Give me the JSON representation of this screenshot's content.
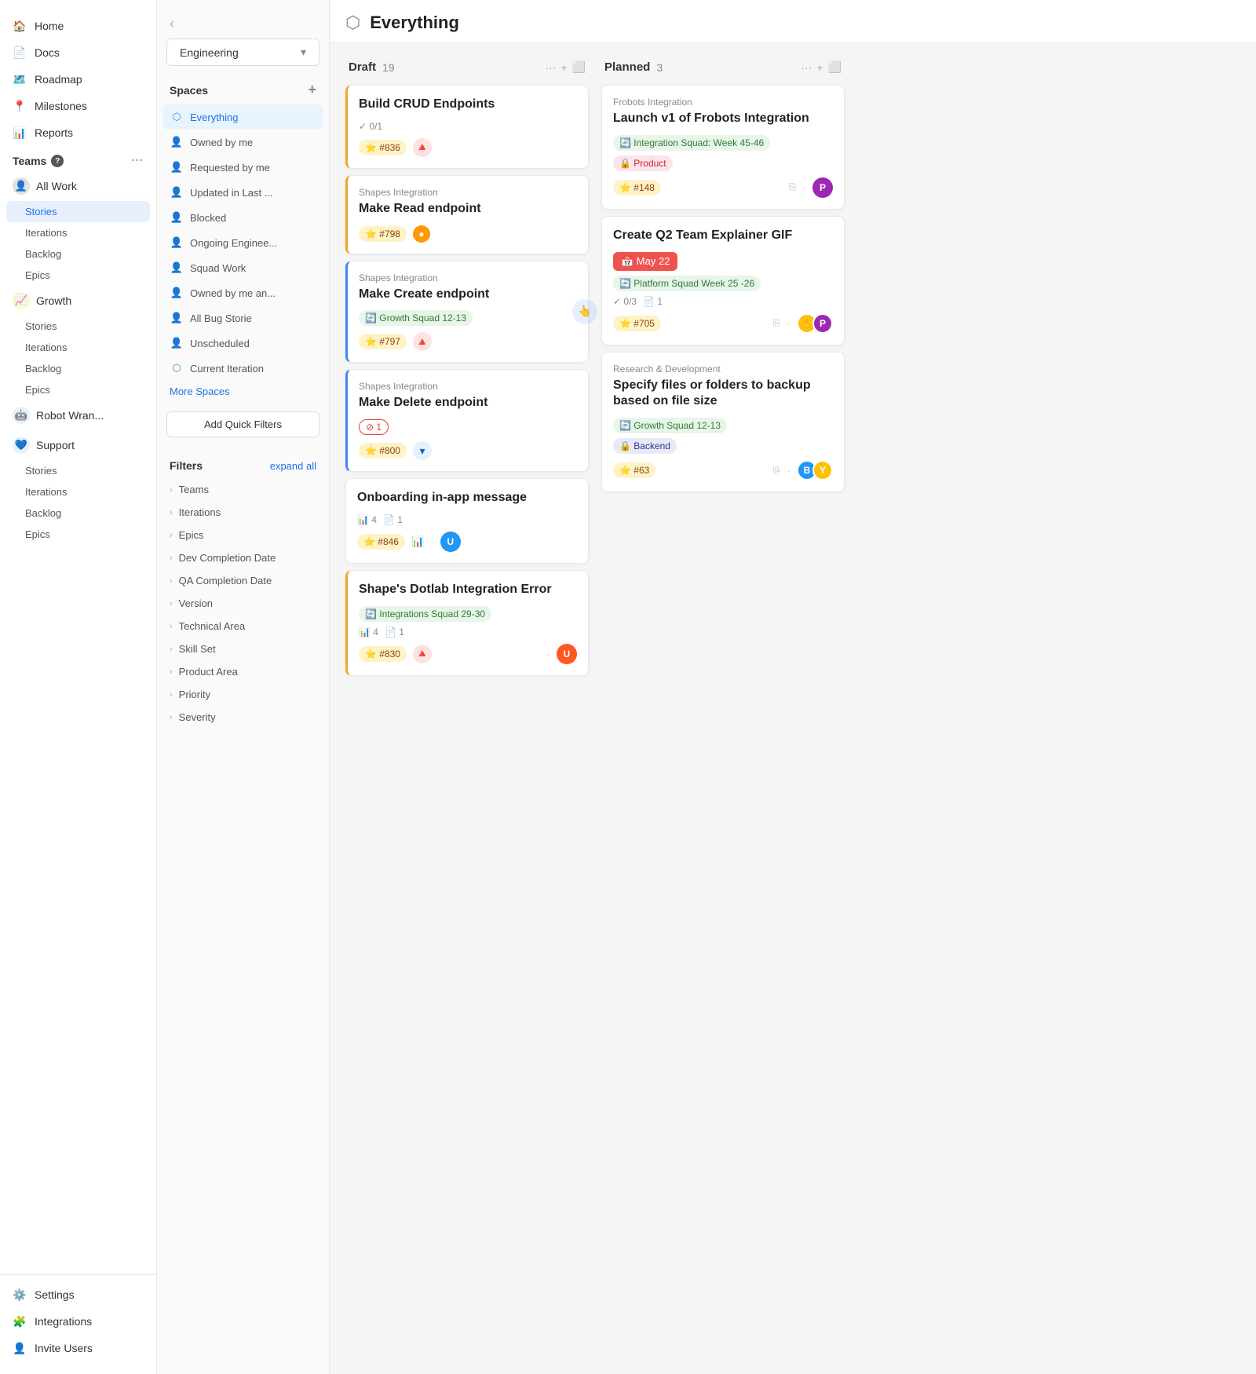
{
  "leftSidebar": {
    "navItems": [
      {
        "id": "home",
        "label": "Home",
        "icon": "🏠"
      },
      {
        "id": "docs",
        "label": "Docs",
        "icon": "📄"
      },
      {
        "id": "roadmap",
        "label": "Roadmap",
        "icon": "🗺️"
      },
      {
        "id": "milestones",
        "label": "Milestones",
        "icon": "📍"
      },
      {
        "id": "reports",
        "label": "Reports",
        "icon": "📊"
      }
    ],
    "teamsLabel": "Teams",
    "teams": [
      {
        "id": "all-work",
        "label": "All Work",
        "icon": "👤",
        "iconBg": "#e0e0e0",
        "subitems": [
          {
            "id": "stories",
            "label": "Stories",
            "active": true
          },
          {
            "id": "iterations",
            "label": "Iterations"
          },
          {
            "id": "backlog",
            "label": "Backlog"
          },
          {
            "id": "epics",
            "label": "Epics"
          }
        ]
      },
      {
        "id": "growth",
        "label": "Growth",
        "icon": "📈",
        "iconBg": "#fff9c4",
        "subitems": [
          {
            "id": "stories",
            "label": "Stories"
          },
          {
            "id": "iterations",
            "label": "Iterations"
          },
          {
            "id": "backlog",
            "label": "Backlog"
          },
          {
            "id": "epics",
            "label": "Epics"
          }
        ]
      },
      {
        "id": "robot",
        "label": "Robot Wran...",
        "icon": "🤖",
        "iconBg": "#e3f2fd"
      },
      {
        "id": "support",
        "label": "Support",
        "icon": "💙",
        "iconBg": "#e3f2fd",
        "subitems": [
          {
            "id": "stories",
            "label": "Stories"
          },
          {
            "id": "iterations",
            "label": "Iterations"
          },
          {
            "id": "backlog",
            "label": "Backlog"
          },
          {
            "id": "epics",
            "label": "Epics"
          }
        ]
      }
    ],
    "bottomNav": [
      {
        "id": "settings",
        "label": "Settings",
        "icon": "⚙️"
      },
      {
        "id": "integrations",
        "label": "Integrations",
        "icon": "🧩"
      },
      {
        "id": "invite",
        "label": "Invite Users",
        "icon": "👤"
      }
    ]
  },
  "midSidebar": {
    "dropdown": "Engineering",
    "spacesTitle": "Spaces",
    "spaces": [
      {
        "id": "everything",
        "label": "Everything",
        "active": true,
        "icon": "cube"
      },
      {
        "id": "owned-by-me",
        "label": "Owned by me",
        "icon": "person"
      },
      {
        "id": "requested-by-me",
        "label": "Requested by me",
        "icon": "person"
      },
      {
        "id": "updated-in-last",
        "label": "Updated in Last ...",
        "icon": "person"
      },
      {
        "id": "blocked",
        "label": "Blocked",
        "icon": "person"
      },
      {
        "id": "ongoing-engineer",
        "label": "Ongoing Enginee...",
        "icon": "person"
      },
      {
        "id": "squad-work",
        "label": "Squad Work",
        "icon": "person"
      },
      {
        "id": "owned-by-me-and",
        "label": "Owned by me an...",
        "icon": "person"
      },
      {
        "id": "all-bug-storie",
        "label": "All Bug Storie",
        "icon": "person"
      },
      {
        "id": "unscheduled",
        "label": "Unscheduled",
        "icon": "person"
      },
      {
        "id": "current-iteration",
        "label": "Current Iteration",
        "icon": "cube"
      }
    ],
    "moreSpaces": "More Spaces",
    "addFiltersBtn": "Add Quick Filters",
    "filtersTitle": "Filters",
    "expandAll": "expand all",
    "filters": [
      {
        "id": "teams",
        "label": "Teams"
      },
      {
        "id": "iterations",
        "label": "Iterations"
      },
      {
        "id": "epics",
        "label": "Epics"
      },
      {
        "id": "dev-completion-date",
        "label": "Dev Completion Date"
      },
      {
        "id": "qa-completion-date",
        "label": "QA Completion Date"
      },
      {
        "id": "version",
        "label": "Version"
      },
      {
        "id": "technical-area",
        "label": "Technical Area"
      },
      {
        "id": "skill-set",
        "label": "Skill Set"
      },
      {
        "id": "product-area",
        "label": "Product Area"
      },
      {
        "id": "priority",
        "label": "Priority"
      },
      {
        "id": "severity",
        "label": "Severity"
      }
    ]
  },
  "main": {
    "pageIcon": "⬡",
    "pageTitle": "Everything",
    "columns": [
      {
        "id": "draft",
        "title": "Draft",
        "count": "19",
        "cards": [
          {
            "id": "card-1",
            "borderColor": "orange",
            "title": "Build CRUD Endpoints",
            "checkLabel": "0/1",
            "badgeNum": "#836",
            "hasPriorityUrgent": true
          },
          {
            "id": "card-2",
            "borderColor": "orange",
            "label": "Shapes Integration",
            "title": "Make Read endpoint",
            "badgeNum": "#798",
            "hasOrangeCircle": true
          },
          {
            "id": "card-3",
            "borderColor": "blue",
            "label": "Shapes Integration",
            "title": "Make Create endpoint",
            "iteration": "Growth Squad 12-13",
            "badgeNum": "#797",
            "hasPriorityUrgent": true,
            "hasCursor": true
          },
          {
            "id": "card-4",
            "borderColor": "blue",
            "label": "Shapes Integration",
            "title": "Make Delete endpoint",
            "blockerCount": "1",
            "badgeNum": "#800",
            "hasDownPriority": true
          },
          {
            "id": "card-5",
            "borderColor": "none",
            "title": "Onboarding in-app message",
            "statCount": "4",
            "docCount": "1",
            "badgeNum": "#846",
            "hasAvatar": true,
            "hasChart": true
          },
          {
            "id": "card-6",
            "borderColor": "orange",
            "title": "Shape's Dotlab Integration Error",
            "iteration": "Integrations Squad 29-30",
            "statCount": "4",
            "docCount": "1",
            "badgeNum": "#830",
            "hasAvatar": true,
            "hasPriorityUrgent": true
          }
        ]
      },
      {
        "id": "planned",
        "title": "Planned",
        "count": "3",
        "cards": [
          {
            "id": "pcard-1",
            "label": "Frobots Integration",
            "title": "Launch v1 of Frobots Integration",
            "iteration": "Integration Squad: Week 45-46",
            "product": "Product",
            "badgeNum": "#148",
            "hasAvatar": true,
            "avatarColor": "purple"
          },
          {
            "id": "pcard-2",
            "title": "Create Q2 Team Explainer GIF",
            "dateLabel": "May 22",
            "iteration": "Platform Squad Week 25 -26",
            "checkLabel": "0/3",
            "docCount": "1",
            "badgeNum": "#705",
            "hasAvatarGroup": true
          },
          {
            "id": "pcard-3",
            "label": "Research & Development",
            "title": "Specify files or folders to backup based on file size",
            "iteration": "Growth Squad 12-13",
            "backend": "Backend",
            "badgeNum": "#63",
            "hasAvatarGroup2": true
          }
        ]
      }
    ]
  }
}
